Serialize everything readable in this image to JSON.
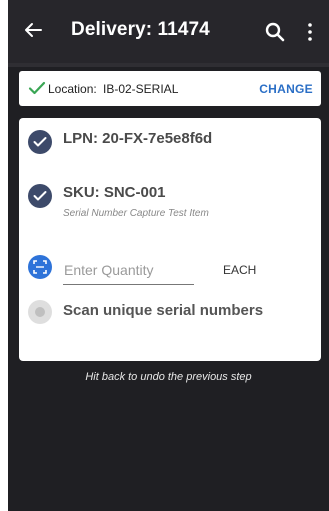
{
  "header": {
    "title": "Delivery: 11474",
    "back_icon": "arrow-left-icon",
    "search_icon": "search-icon",
    "more_icon": "more-vert-icon"
  },
  "location": {
    "label": "Location:",
    "value": "IB-02-SERIAL",
    "change_label": "CHANGE",
    "check_color": "#3aa655"
  },
  "steps": {
    "lpn": {
      "text": "LPN: 20-FX-7e5e8f6d",
      "status": "done"
    },
    "sku": {
      "text": "SKU: SNC-001",
      "description": "Serial Number Capture Test Item",
      "status": "done"
    },
    "quantity": {
      "placeholder": "Enter Quantity",
      "value": "",
      "uom": "EACH",
      "status": "active"
    },
    "serial": {
      "text": "Scan unique serial numbers",
      "status": "pending"
    }
  },
  "hint": "Hit back to undo the previous step",
  "colors": {
    "appbar": "#27262b",
    "background": "#1f1f23",
    "done": "#3d4a6a",
    "active": "#2e73d9",
    "link": "#2b6fc6"
  }
}
